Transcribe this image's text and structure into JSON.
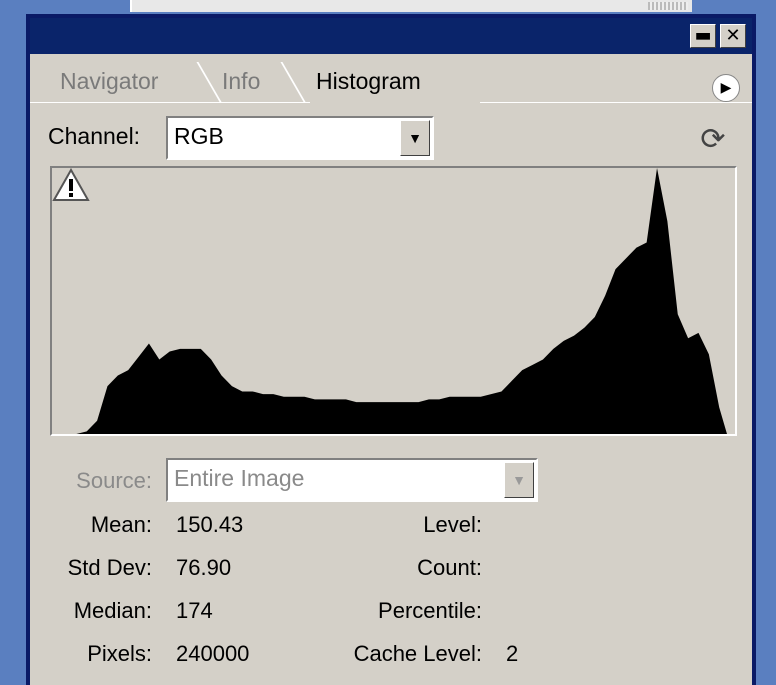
{
  "tabs": [
    {
      "label": "Navigator",
      "active": false
    },
    {
      "label": "Info",
      "active": false
    },
    {
      "label": "Histogram",
      "active": true
    }
  ],
  "window_buttons": {
    "minimize": "▬",
    "close": "✕"
  },
  "channel": {
    "label": "Channel:",
    "value": "RGB"
  },
  "source": {
    "label": "Source:",
    "value": "Entire Image",
    "disabled": true
  },
  "stats": {
    "mean_label": "Mean:",
    "mean": "150.43",
    "stddev_label": "Std Dev:",
    "stddev": "76.90",
    "median_label": "Median:",
    "median": "174",
    "pixels_label": "Pixels:",
    "pixels": "240000",
    "level_label": "Level:",
    "level": "",
    "count_label": "Count:",
    "count": "",
    "percentile_label": "Percentile:",
    "percentile": "",
    "cache_label": "Cache Level:",
    "cache": "2"
  },
  "icons": {
    "refresh": "refresh-icon",
    "warning": "warning-icon",
    "menu": "panel-menu-icon"
  },
  "colors": {
    "title_bar": "#0a246a",
    "panel": "#d4d0c8",
    "histogram": "#000000"
  },
  "chart_data": {
    "type": "area",
    "title": "",
    "xlabel": "",
    "ylabel": "",
    "xlim": [
      0,
      255
    ],
    "ylim": [
      0,
      1
    ],
    "x": [
      0,
      4,
      8,
      12,
      16,
      20,
      24,
      28,
      32,
      36,
      40,
      44,
      48,
      52,
      56,
      60,
      64,
      68,
      72,
      76,
      80,
      84,
      88,
      92,
      96,
      100,
      104,
      108,
      112,
      116,
      120,
      124,
      128,
      132,
      136,
      140,
      144,
      148,
      152,
      156,
      160,
      164,
      168,
      172,
      176,
      180,
      184,
      188,
      192,
      196,
      200,
      204,
      208,
      212,
      216,
      220,
      224,
      228,
      232,
      236,
      240,
      244,
      248,
      252,
      255
    ],
    "values": [
      0.0,
      0.0,
      0.01,
      0.05,
      0.18,
      0.22,
      0.24,
      0.29,
      0.34,
      0.28,
      0.31,
      0.32,
      0.32,
      0.32,
      0.28,
      0.22,
      0.18,
      0.16,
      0.16,
      0.15,
      0.15,
      0.14,
      0.14,
      0.14,
      0.13,
      0.13,
      0.13,
      0.13,
      0.12,
      0.12,
      0.12,
      0.12,
      0.12,
      0.12,
      0.12,
      0.13,
      0.13,
      0.14,
      0.14,
      0.14,
      0.14,
      0.15,
      0.16,
      0.2,
      0.24,
      0.26,
      0.28,
      0.32,
      0.35,
      0.37,
      0.4,
      0.44,
      0.52,
      0.62,
      0.66,
      0.7,
      0.72,
      1.0,
      0.8,
      0.45,
      0.36,
      0.38,
      0.3,
      0.1,
      0.0
    ]
  }
}
